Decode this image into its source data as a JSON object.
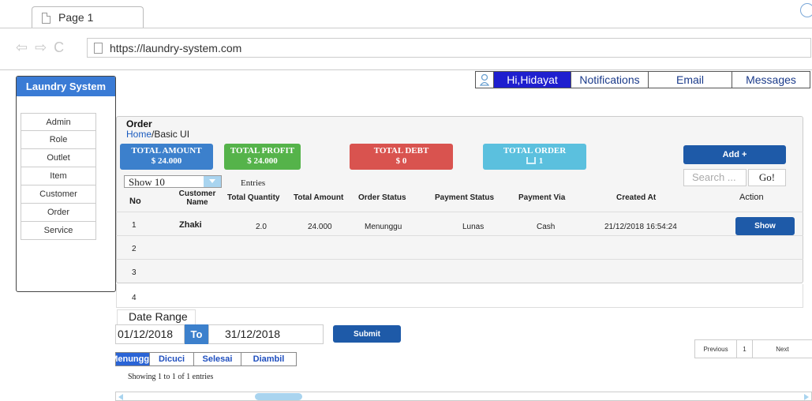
{
  "browser": {
    "tab_title": "Page 1",
    "nav_arrows": "⇦ ⇨ C",
    "url": "https://laundry-system.com"
  },
  "topnav": {
    "greeting": "Hi,Hidayat",
    "notifications": "Notifications",
    "email": "Email",
    "messages": "Messages"
  },
  "sidebar": {
    "title": "Laundry System",
    "items": [
      "Admin",
      "Role",
      "Outlet",
      "Item",
      "Customer",
      "Order",
      "Service"
    ]
  },
  "page": {
    "title": "Order",
    "breadcrumb_home": "Home",
    "breadcrumb_current": "/Basic UI"
  },
  "cards": {
    "amount_label": "TOTAL AMOUNT",
    "amount_value": "$ 24.000",
    "profit_label": "TOTAL PROFIT",
    "profit_value": "$ 24.000",
    "debt_label": "TOTAL DEBT",
    "debt_value": "$ 0",
    "order_label": "TOTAL ORDER",
    "order_value": "1"
  },
  "controls": {
    "add_label": "Add +",
    "search_placeholder": "Search ...",
    "go_label": "Go!",
    "show_value": "Show 10",
    "entries_label": "Entries"
  },
  "table": {
    "headers": {
      "no": "No",
      "customer_name": "Customer Name",
      "total_quantity": "Total Quantity",
      "total_amount": "Total Amount",
      "order_status": "Order Status",
      "payment_status": "Payment Status",
      "payment_via": "Payment Via",
      "created_at": "Created At",
      "action": "Action"
    },
    "row1": {
      "no": "1",
      "customer_name": "Zhaki",
      "total_quantity": "2.0",
      "total_amount": "24.000",
      "order_status": "Menunggu",
      "payment_status": "Lunas",
      "payment_via": "Cash",
      "created_at": "21/12/2018 16:54:24",
      "action": "Show"
    },
    "empty_rows": [
      "2",
      "3",
      "4"
    ]
  },
  "date_range": {
    "label": "Date Range",
    "from": "01/12/2018",
    "to_label": "To",
    "to": "31/12/2018",
    "submit_label": "Submit"
  },
  "pagination": {
    "previous": "Previous",
    "page": "1",
    "next": "Next"
  },
  "status_tabs": [
    "Menunggu",
    "Dicuci",
    "Selesai",
    "Diambil"
  ],
  "footer": {
    "showing": "Showing 1 to 1 of 1 entries"
  },
  "colors": {
    "primary": "#1e5aa8",
    "amount": "#3c80cc",
    "profit": "#55b34a",
    "debt": "#d9534f",
    "order": "#5bc0de"
  }
}
